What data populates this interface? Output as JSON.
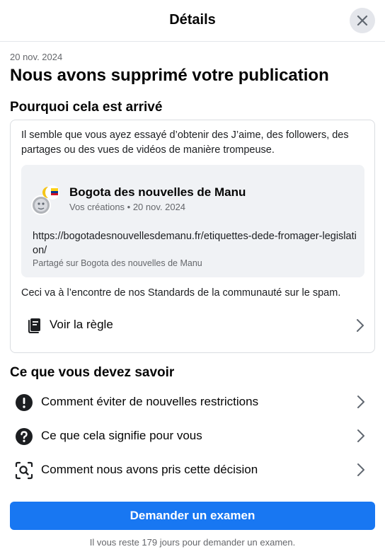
{
  "header": {
    "title": "Détails",
    "close_icon": "close-icon"
  },
  "post_removed": {
    "date": "20 nov. 2024",
    "title": "Nous avons supprimé votre publication"
  },
  "why": {
    "title": "Pourquoi cela est arrivé",
    "description": "Il semble que vous ayez essayé d’obtenir des J’aime, des followers, des partages ou des vues de vidéos de manière trompeuse.",
    "post": {
      "page_name": "Bogota des nouvelles de Manu",
      "meta": "Vos créations • 20 nov. 2024",
      "link": "https://bogotadesnouvellesdemanu.fr/etiquettes-dede-fromager-legislation/",
      "shared": "Partagé sur Bogota des nouvelles de Manu",
      "avatar_icon": "page-avatar"
    },
    "note": "Ceci va à l’encontre de nos Standards de la communauté sur le spam.",
    "rule_link": {
      "label": "Voir la règle",
      "icon": "rules-book-icon"
    }
  },
  "know": {
    "title": "Ce que vous devez savoir",
    "items": [
      {
        "label": "Comment éviter de nouvelles restrictions",
        "icon": "exclamation-circle-icon"
      },
      {
        "label": "Ce que cela signifie pour vous",
        "icon": "question-circle-icon"
      },
      {
        "label": "Comment nous avons pris cette décision",
        "icon": "magnifier-focus-icon"
      }
    ]
  },
  "actions": {
    "review_button": "Demander un examen",
    "footer": "Il vous reste 179 jours pour demander un examen."
  },
  "colors": {
    "primary": "#1877f2",
    "secondary_text": "#65676b",
    "border": "#dadde1",
    "surface": "#f0f2f5"
  }
}
